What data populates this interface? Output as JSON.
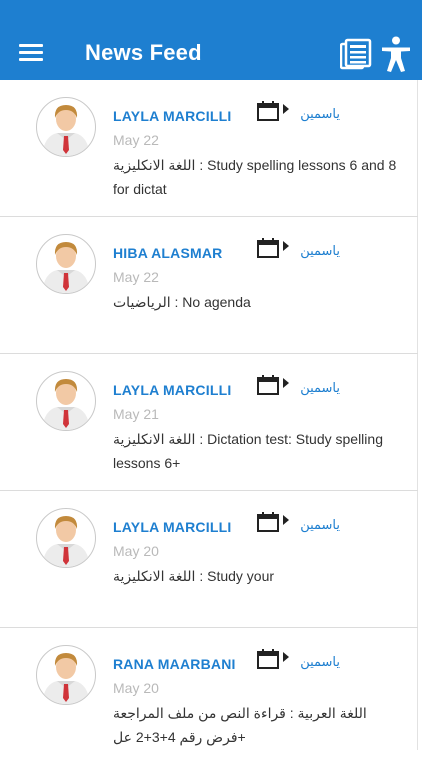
{
  "header": {
    "title": "News Feed",
    "background_color": "#1e7fd0",
    "menu_icon": "hamburger-menu-icon",
    "feed_icon": "newspaper-icon",
    "accessibility_icon": "accessibility-icon"
  },
  "feed": {
    "items": [
      {
        "author": "LAYLA MARCILLI",
        "date": "May 22",
        "child": "ياسمين",
        "text": "اللغة الانكليزية : Study spelling lessons 6 and 8 for dictat"
      },
      {
        "author": "HIBA ALASMAR",
        "date": "May 22",
        "child": "ياسمين",
        "text": "الرياضيات : No agenda"
      },
      {
        "author": "LAYLA MARCILLI",
        "date": "May 21",
        "child": "ياسمين",
        "text": "اللغة الانكليزية : Dictation test: Study spelling lessons 6+"
      },
      {
        "author": "LAYLA MARCILLI",
        "date": "May 20",
        "child": "ياسمين",
        "text": "اللغة الانكليزية : Study your"
      },
      {
        "author": "RANA MAARBANI",
        "date": "May 20",
        "child": "ياسمين",
        "text": "اللغة العربية : قراءة النص من ملف المراجعة +فرض رقم 4+3+2 عل"
      }
    ]
  }
}
